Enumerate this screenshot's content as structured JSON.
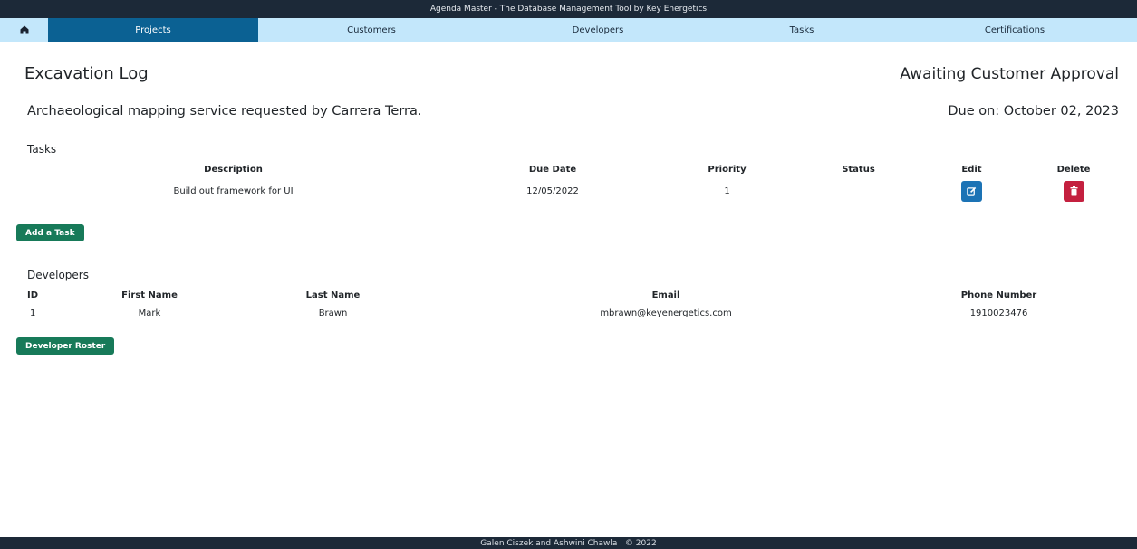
{
  "app": {
    "title": "Agenda Master - The Database Management Tool by Key Energetics"
  },
  "nav": {
    "home_icon": "home-icon",
    "items": [
      {
        "label": "Projects",
        "active": true
      },
      {
        "label": "Customers",
        "active": false
      },
      {
        "label": "Developers",
        "active": false
      },
      {
        "label": "Tasks",
        "active": false
      },
      {
        "label": "Certifications",
        "active": false
      }
    ]
  },
  "project": {
    "title": "Excavation Log",
    "status": "Awaiting Customer Approval",
    "description": "Archaeological mapping service requested by Carrera Terra.",
    "due": "Due on: October 02, 2023"
  },
  "tasks": {
    "section_label": "Tasks",
    "headers": {
      "description": "Description",
      "due_date": "Due Date",
      "priority": "Priority",
      "status": "Status",
      "edit": "Edit",
      "delete": "Delete"
    },
    "rows": [
      {
        "description": "Build out framework for UI",
        "due_date": "12/05/2022",
        "priority": "1",
        "status": ""
      }
    ],
    "add_button": "Add a Task"
  },
  "developers": {
    "section_label": "Developers",
    "headers": {
      "id": "ID",
      "first_name": "First Name",
      "last_name": "Last Name",
      "email": "Email",
      "phone": "Phone Number"
    },
    "rows": [
      {
        "id": "1",
        "first_name": "Mark",
        "last_name": "Brawn",
        "email": "mbrawn@keyenergetics.com",
        "phone": "1910023476"
      }
    ],
    "roster_button": "Developer Roster"
  },
  "footer": {
    "text": "Galen Ciszek and Ashwini Chawla   © 2022"
  },
  "colors": {
    "header_bg": "#1c2938",
    "nav_bg": "#c3e7fb",
    "nav_active": "#0b6193",
    "button_green": "#177a59",
    "edit_blue": "#1c73b5",
    "delete_red": "#c4203f"
  }
}
